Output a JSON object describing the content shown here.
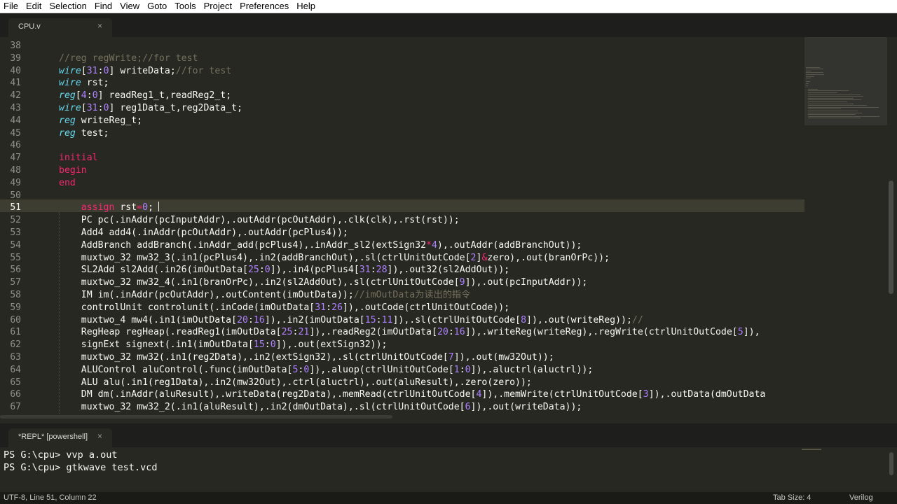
{
  "menu": [
    "File",
    "Edit",
    "Selection",
    "Find",
    "View",
    "Goto",
    "Tools",
    "Project",
    "Preferences",
    "Help"
  ],
  "editor": {
    "tab_label": "CPU.v",
    "tab_close": "×",
    "current_line": 51,
    "line_numbers": [
      "38",
      "39",
      "40",
      "41",
      "42",
      "43",
      "44",
      "45",
      "46",
      "47",
      "48",
      "49",
      "50",
      "51",
      "52",
      "53",
      "54",
      "55",
      "56",
      "57",
      "58",
      "59",
      "60",
      "61",
      "62",
      "63",
      "64",
      "65",
      "66",
      "67"
    ],
    "lines": [
      [],
      [
        [
          "c",
          "//reg regWrite;//for test"
        ]
      ],
      [
        [
          "k",
          "wire"
        ],
        [
          "n",
          "["
        ],
        [
          "m",
          "31"
        ],
        [
          "n",
          ":"
        ],
        [
          "m",
          "0"
        ],
        [
          "n",
          "] writeData;"
        ],
        [
          "c",
          "//for test"
        ]
      ],
      [
        [
          "k",
          "wire"
        ],
        [
          "n",
          " rst;"
        ]
      ],
      [
        [
          "k",
          "reg"
        ],
        [
          "n",
          "["
        ],
        [
          "m",
          "4"
        ],
        [
          "n",
          ":"
        ],
        [
          "m",
          "0"
        ],
        [
          "n",
          "] readReg1_t,readReg2_t;"
        ]
      ],
      [
        [
          "k",
          "wire"
        ],
        [
          "n",
          "["
        ],
        [
          "m",
          "31"
        ],
        [
          "n",
          ":"
        ],
        [
          "m",
          "0"
        ],
        [
          "n",
          "] reg1Data_t,reg2Data_t;"
        ]
      ],
      [
        [
          "k",
          "reg"
        ],
        [
          "n",
          " writeReg_t;"
        ]
      ],
      [
        [
          "k",
          "reg"
        ],
        [
          "n",
          " test;"
        ]
      ],
      [],
      [
        [
          "s",
          "initial"
        ]
      ],
      [
        [
          "s",
          "begin"
        ]
      ],
      [
        [
          "s",
          "end"
        ]
      ],
      [],
      [
        [
          "n",
          "    "
        ],
        [
          "s",
          "assign"
        ],
        [
          "n",
          " rst"
        ],
        [
          "s",
          "="
        ],
        [
          "m",
          "0"
        ],
        [
          "n",
          ";"
        ]
      ],
      [
        [
          "n",
          "    PC pc(.inAddr(pcInputAddr),.outAddr(pcOutAddr),.clk(clk),.rst(rst));"
        ]
      ],
      [
        [
          "n",
          "    Add4 add4(.inAddr(pcOutAddr),.outAddr(pcPlus4));"
        ]
      ],
      [
        [
          "n",
          "    AddBranch addBranch(.inAddr_add(pcPlus4),.inAddr_sl2(extSign32"
        ],
        [
          "s",
          "*"
        ],
        [
          "m",
          "4"
        ],
        [
          "n",
          "),.outAddr(addBranchOut));"
        ]
      ],
      [
        [
          "n",
          "    muxtwo_32 mw32_3(.in1(pcPlus4),.in2(addBranchOut),.sl(ctrlUnitOutCode["
        ],
        [
          "m",
          "2"
        ],
        [
          "n",
          "]"
        ],
        [
          "s",
          "&"
        ],
        [
          "n",
          "zero),.out(branOrPc));"
        ]
      ],
      [
        [
          "n",
          "    SL2Add sl2Add(.in26(imOutData["
        ],
        [
          "m",
          "25"
        ],
        [
          "n",
          ":"
        ],
        [
          "m",
          "0"
        ],
        [
          "n",
          "]),.in4(pcPlus4["
        ],
        [
          "m",
          "31"
        ],
        [
          "n",
          ":"
        ],
        [
          "m",
          "28"
        ],
        [
          "n",
          "]),.out32(sl2AddOut));"
        ]
      ],
      [
        [
          "n",
          "    muxtwo_32 mw32_4(.in1(branOrPc),.in2(sl2AddOut),.sl(ctrlUnitOutCode["
        ],
        [
          "m",
          "9"
        ],
        [
          "n",
          "]),.out(pcInputAddr));"
        ]
      ],
      [
        [
          "n",
          "    IM im(.inAddr(pcOutAddr),.outContent(imOutData));"
        ],
        [
          "c",
          "//imOutData为读出的指令"
        ]
      ],
      [
        [
          "n",
          "    controlUnit controlunit(.inCode(imOutData["
        ],
        [
          "m",
          "31"
        ],
        [
          "n",
          ":"
        ],
        [
          "m",
          "26"
        ],
        [
          "n",
          "]),.outCode(ctrlUnitOutCode));"
        ]
      ],
      [
        [
          "n",
          "    muxtwo_4 mw4(.in1(imOutData["
        ],
        [
          "m",
          "20"
        ],
        [
          "n",
          ":"
        ],
        [
          "m",
          "16"
        ],
        [
          "n",
          "]),.in2(imOutData["
        ],
        [
          "m",
          "15"
        ],
        [
          "n",
          ":"
        ],
        [
          "m",
          "11"
        ],
        [
          "n",
          "]),.sl(ctrlUnitOutCode["
        ],
        [
          "m",
          "8"
        ],
        [
          "n",
          "]),.out(writeReg));"
        ],
        [
          "c",
          "//"
        ]
      ],
      [
        [
          "n",
          "    RegHeap regHeap(.readReg1(imOutData["
        ],
        [
          "m",
          "25"
        ],
        [
          "n",
          ":"
        ],
        [
          "m",
          "21"
        ],
        [
          "n",
          "]),.readReg2(imOutData["
        ],
        [
          "m",
          "20"
        ],
        [
          "n",
          ":"
        ],
        [
          "m",
          "16"
        ],
        [
          "n",
          "]),.writeReg(writeReg),.regWrite(ctrlUnitOutCode["
        ],
        [
          "m",
          "5"
        ],
        [
          "n",
          "]),"
        ]
      ],
      [
        [
          "n",
          "    signExt signext(.in1(imOutData["
        ],
        [
          "m",
          "15"
        ],
        [
          "n",
          ":"
        ],
        [
          "m",
          "0"
        ],
        [
          "n",
          "]),.out(extSign32));"
        ]
      ],
      [
        [
          "n",
          "    muxtwo_32 mw32(.in1(reg2Data),.in2(extSign32),.sl(ctrlUnitOutCode["
        ],
        [
          "m",
          "7"
        ],
        [
          "n",
          "]),.out(mw32Out));"
        ]
      ],
      [
        [
          "n",
          "    ALUControl aluControl(.func(imOutData["
        ],
        [
          "m",
          "5"
        ],
        [
          "n",
          ":"
        ],
        [
          "m",
          "0"
        ],
        [
          "n",
          "]),.aluop(ctrlUnitOutCode["
        ],
        [
          "m",
          "1"
        ],
        [
          "n",
          ":"
        ],
        [
          "m",
          "0"
        ],
        [
          "n",
          "]),.aluctrl(aluctrl));"
        ]
      ],
      [
        [
          "n",
          "    ALU alu(.in1(reg1Data),.in2(mw32Out),.ctrl(aluctrl),.out(aluResult),.zero(zero));"
        ]
      ],
      [
        [
          "n",
          "    DM dm(.inAddr(aluResult),.writeData(reg2Data),.memRead(ctrlUnitOutCode["
        ],
        [
          "m",
          "4"
        ],
        [
          "n",
          "]),.memWrite(ctrlUnitOutCode["
        ],
        [
          "m",
          "3"
        ],
        [
          "n",
          "]),.outData(dmOutData"
        ]
      ],
      [
        [
          "n",
          "    muxtwo_32 mw32_2(.in1(aluResult),.in2(dmOutData),.sl(ctrlUnitOutCode["
        ],
        [
          "m",
          "6"
        ],
        [
          "n",
          "]),.out(writeData));"
        ]
      ]
    ]
  },
  "panel": {
    "tab_label": "*REPL* [powershell]",
    "tab_close": "×",
    "line1": "PS G:\\cpu> vvp a.out",
    "line2": "PS G:\\cpu> gtkwave test.vcd"
  },
  "status": {
    "position": "UTF-8, Line 51, Column 22",
    "tab_size": "Tab Size: 4",
    "syntax": "Verilog"
  },
  "colors": {
    "background": "#272822",
    "keyword_type": "#66d9ef",
    "keyword_control": "#f92672",
    "number": "#ae81ff",
    "comment": "#75715e",
    "text": "#f8f8f2"
  }
}
